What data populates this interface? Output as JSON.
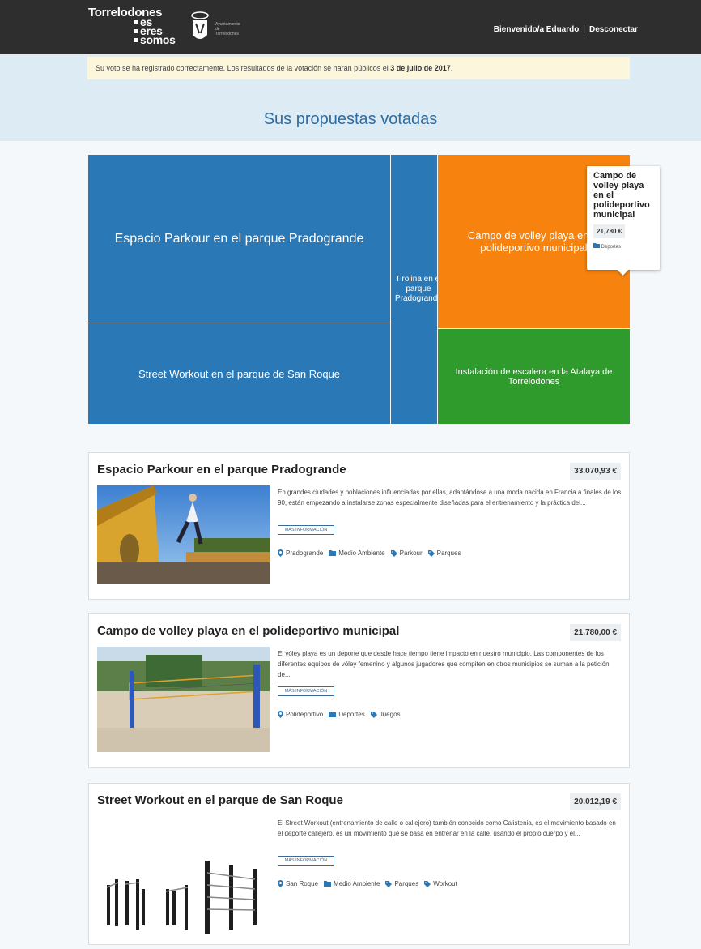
{
  "header": {
    "logo_line1": "Torrelodones",
    "logo_line2": "es",
    "logo_line3": "eres",
    "logo_line4": "somos",
    "ayuntamiento_lines": [
      "Ayuntamiento",
      "de",
      "Torrelodones"
    ],
    "welcome": "Bienvenido/a Eduardo",
    "separator": "|",
    "logout": "Desconectar"
  },
  "alert": {
    "text_before": "Su voto se ha registrado correctamente. Los resultados de la votación se harán públicos el ",
    "text_bold": "3 de julio de 2017",
    "text_after": "."
  },
  "page_title": "Sus propuestas votadas",
  "treemap": {
    "cells": [
      {
        "label": "Espacio Parkour en el parque Pradogrande",
        "color": "#2a78b5"
      },
      {
        "label": "Street Workout en el parque de San Roque",
        "color": "#2a78b5"
      },
      {
        "label": "Tirolina en el parque Pradogrande",
        "color": "#2a78b5"
      },
      {
        "label": "Campo de volley playa en el polideportivo municipal",
        "color": "#f7830e"
      },
      {
        "label": "Instalación de escalera en la Atalaya de Torrelodones",
        "color": "#2f9b2c"
      }
    ],
    "tooltip": {
      "title": "Campo de volley playa en el polideportivo municipal",
      "amount": "21,780 €",
      "category": "Deportes"
    }
  },
  "proposals": [
    {
      "title": "Espacio Parkour en el parque Pradogrande",
      "amount": "33.070,93 €",
      "description": "En grandes ciudades y poblaciones influenciadas por ellas, adaptándose a una moda nacida en Francia a finales de los 90, están empezando a instalarse zonas especialmente diseñadas para el entrenamiento y la práctica del...",
      "more_label": "MÁS INFORMACIÓN",
      "location": "Pradogrande",
      "category": "Medio Ambiente",
      "tags": [
        "Parkour",
        "Parques"
      ]
    },
    {
      "title": "Campo de volley playa en el polideportivo municipal",
      "amount": "21.780,00 €",
      "description": "El vóley playa es un deporte que desde hace tiempo tiene impacto en nuestro municipio. Las componentes de los diferentes equipos de vóley femenino y algunos jugadores que compiten en otros municipios se suman a la petición de...",
      "more_label": "MÁS INFORMACIÓN",
      "location": "Polideportivo",
      "category": "Deportes",
      "tags": [
        "Juegos"
      ]
    },
    {
      "title": "Street Workout en el parque de San Roque",
      "amount": "20.012,19 €",
      "description": "El Street Workout (entrenamiento de calle o callejero) también conocido como Calistenia, es el movimiento basado en el deporte callejero, es un movimiento que se basa en entrenar en la calle, usando el propio cuerpo y el...",
      "more_label": "MÁS INFORMACIÓN",
      "location": "San Roque",
      "category": "Medio Ambiente",
      "tags": [
        "Parques",
        "Workout"
      ]
    }
  ],
  "colors": {
    "topbar": "#2e2e2e",
    "hero": "#ddebf5",
    "alert_bg": "#fcf6dc",
    "title": "#2f6c9f",
    "link_blue": "#3c6a98"
  },
  "icons": {
    "location": "map-pin-icon",
    "category": "folder-icon",
    "tag": "tag-icon"
  }
}
